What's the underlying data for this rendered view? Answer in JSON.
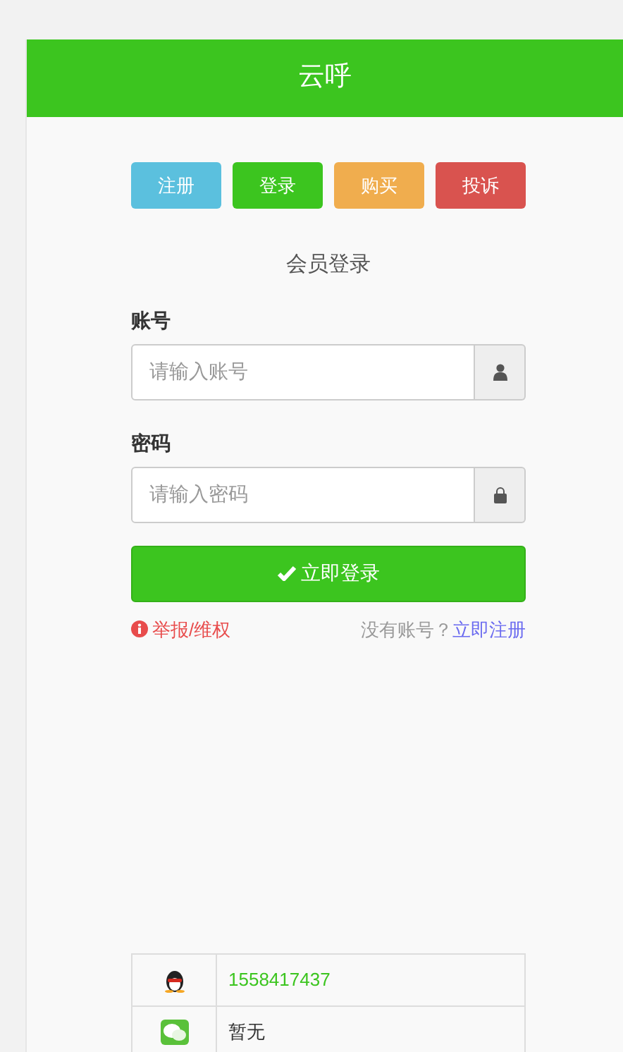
{
  "header": {
    "title": "云呼"
  },
  "nav_buttons": [
    {
      "label": "注册",
      "color": "#5bc0de"
    },
    {
      "label": "登录",
      "color": "#3cc51f"
    },
    {
      "label": "购买",
      "color": "#f0ad4e"
    },
    {
      "label": "投诉",
      "color": "#d9534f"
    }
  ],
  "form": {
    "title": "会员登录",
    "fields": [
      {
        "label": "账号",
        "placeholder": "请输入账号",
        "kind": "user"
      },
      {
        "label": "密码",
        "placeholder": "请输入密码",
        "kind": "password"
      }
    ],
    "submit": "立即登录",
    "report_link": "举报/维权",
    "no_account": "没有账号？",
    "register_link": "立即注册"
  },
  "contacts": [
    {
      "kind": "qq",
      "value": "1558417437"
    },
    {
      "kind": "wechat",
      "value": "暂无"
    }
  ]
}
